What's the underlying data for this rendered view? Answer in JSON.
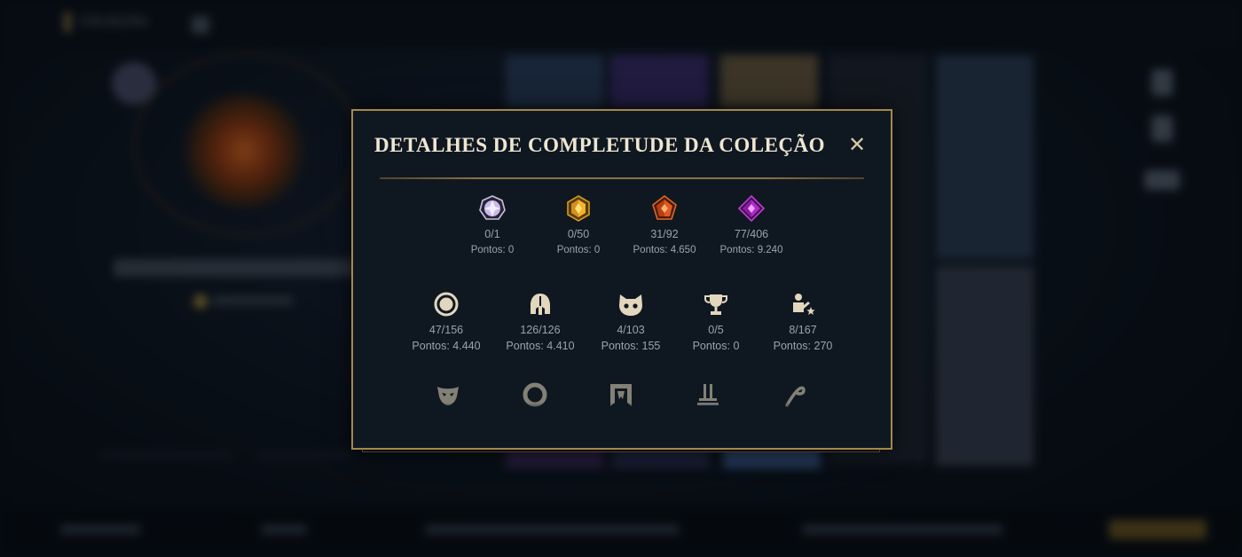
{
  "background": {
    "back_label": "COLEÇÃO"
  },
  "modal": {
    "title": "DETALHES DE COMPLETUDE DA COLEÇÃO",
    "close_symbol": "✕",
    "row1": [
      {
        "icon": "diamond-gem-icon",
        "count": "0/1",
        "points": "Pontos: 0"
      },
      {
        "icon": "gold-gem-icon",
        "count": "0/50",
        "points": "Pontos: 0"
      },
      {
        "icon": "orange-gem-icon",
        "count": "31/92",
        "points": "Pontos: 4.650"
      },
      {
        "icon": "purple-gem-icon",
        "count": "77/406",
        "points": "Pontos: 9.240"
      }
    ],
    "row2": [
      {
        "icon": "ring-icon",
        "count": "47/156",
        "points": "Pontos: 4.440"
      },
      {
        "icon": "helmet-icon",
        "count": "126/126",
        "points": "Pontos: 4.410"
      },
      {
        "icon": "creature-face-icon",
        "count": "4/103",
        "points": "Pontos: 155"
      },
      {
        "icon": "trophy-icon",
        "count": "0/5",
        "points": "Pontos: 0"
      },
      {
        "icon": "emote-figure-icon",
        "count": "8/167",
        "points": "Pontos: 270"
      }
    ],
    "row3": [
      "mask-icon",
      "ward-ring-icon",
      "banner-icon",
      "pedestal-icon",
      "swirl-icon"
    ]
  },
  "colors": {
    "frame_gold": "#a4884b",
    "title_text": "#efe6d2",
    "stat_text": "#9aa3ad",
    "icon_beige": "#e2d6bd"
  }
}
